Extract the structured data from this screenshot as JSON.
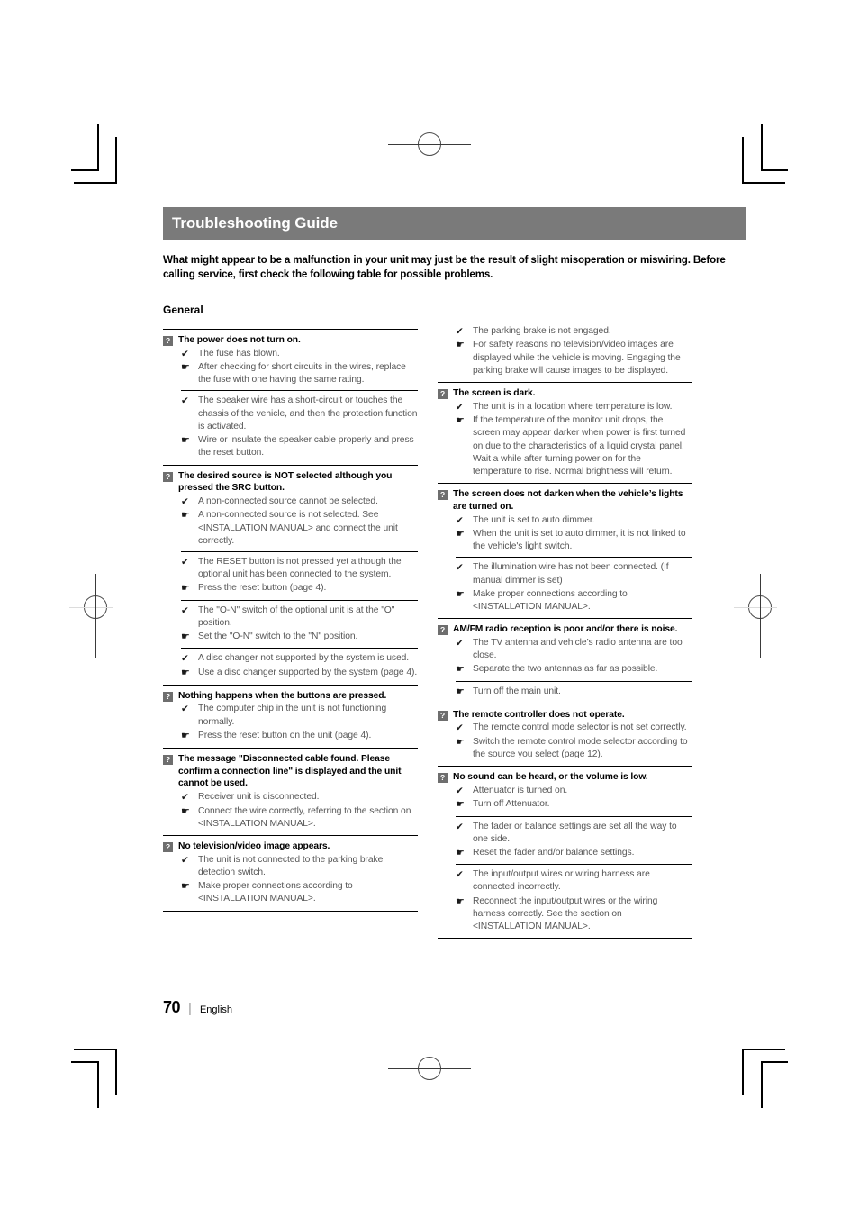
{
  "header": {
    "title": "Troubleshooting Guide",
    "intro": "What might appear to be a malfunction in your unit may just be the result of slight misoperation or miswiring. Before calling service, first check the following table for possible problems.",
    "section": "General"
  },
  "symbols": {
    "question_badge": "?",
    "cause_check": "✔",
    "remedy_hand": "☛"
  },
  "colors": {
    "title_bar_bg": "#7a7a7a",
    "title_bar_text": "#ffffff",
    "badge_bg": "#6e6e6e",
    "body_text": "#565656",
    "rule": "#000000"
  },
  "left_column": [
    {
      "question": "The power does not turn on.",
      "groups": [
        {
          "items": [
            {
              "type": "cause",
              "text": "The fuse has blown."
            },
            {
              "type": "remedy",
              "text": "After checking for short circuits in the wires, replace the fuse with one having the same rating."
            }
          ]
        },
        {
          "items": [
            {
              "type": "cause",
              "text": "The speaker wire has a short-circuit or touches the chassis of the vehicle, and then the protection function is activated."
            },
            {
              "type": "remedy",
              "text": "Wire or insulate the speaker cable properly and press the reset button."
            }
          ]
        }
      ]
    },
    {
      "question": "The desired source is NOT selected although you pressed the SRC button.",
      "groups": [
        {
          "items": [
            {
              "type": "cause",
              "text": "A non-connected source cannot be selected."
            },
            {
              "type": "remedy",
              "text": "A non-connected source is not selected. See <INSTALLATION MANUAL> and connect the unit correctly."
            }
          ]
        },
        {
          "items": [
            {
              "type": "cause",
              "text": "The RESET button is not pressed yet although the optional unit has been connected to the system."
            },
            {
              "type": "remedy",
              "text": "Press the reset button (page 4)."
            }
          ]
        },
        {
          "items": [
            {
              "type": "cause",
              "text": "The \"O-N\" switch of the optional unit is at the \"O\" position."
            },
            {
              "type": "remedy",
              "text": "Set the \"O-N\" switch to the \"N\" position."
            }
          ]
        },
        {
          "items": [
            {
              "type": "cause",
              "text": "A disc changer not supported by the system is used."
            },
            {
              "type": "remedy",
              "text": "Use a disc changer supported by the system (page 4)."
            }
          ]
        }
      ]
    },
    {
      "question": "Nothing happens when the buttons are pressed.",
      "groups": [
        {
          "items": [
            {
              "type": "cause",
              "text": "The computer chip in the unit is not functioning normally."
            },
            {
              "type": "remedy",
              "text": "Press the reset button on the unit (page 4)."
            }
          ]
        }
      ]
    },
    {
      "question": "The message \"Disconnected cable found. Please confirm a connection line\" is displayed and the unit cannot be used.",
      "groups": [
        {
          "items": [
            {
              "type": "cause",
              "text": "Receiver unit is disconnected."
            },
            {
              "type": "remedy",
              "text": "Connect the wire correctly, referring to the section on <INSTALLATION MANUAL>."
            }
          ]
        }
      ]
    },
    {
      "question": "No television/video image appears.",
      "groups": [
        {
          "items": [
            {
              "type": "cause",
              "text": "The unit is not connected to the parking brake detection switch."
            },
            {
              "type": "remedy",
              "text": "Make proper connections according to <INSTALLATION MANUAL>."
            }
          ]
        }
      ],
      "end_rule": true
    }
  ],
  "right_column": [
    {
      "question": null,
      "continuation": true,
      "groups": [
        {
          "items": [
            {
              "type": "cause",
              "text": "The parking brake is not engaged."
            },
            {
              "type": "remedy",
              "text": "For safety reasons no television/video images are displayed while the vehicle is moving. Engaging the parking brake will cause images to be displayed."
            }
          ]
        }
      ]
    },
    {
      "question": "The screen is dark.",
      "groups": [
        {
          "items": [
            {
              "type": "cause",
              "text": "The unit is in a location where temperature is low."
            },
            {
              "type": "remedy",
              "text": "If the temperature of the monitor unit drops, the screen may appear darker when power is first turned on due to the characteristics of a liquid crystal panel. Wait a while after turning power on for the temperature to rise. Normal brightness will return."
            }
          ]
        }
      ]
    },
    {
      "question": "The screen does not darken when the vehicle’s lights are turned on.",
      "groups": [
        {
          "items": [
            {
              "type": "cause",
              "text": "The unit is set to auto dimmer."
            },
            {
              "type": "remedy",
              "text": "When the unit is set to auto dimmer, it is not linked to the vehicle's light switch."
            }
          ]
        },
        {
          "items": [
            {
              "type": "cause",
              "text": "The illumination wire has not been connected. (If manual dimmer is set)"
            },
            {
              "type": "remedy",
              "text": "Make proper connections according to <INSTALLATION MANUAL>."
            }
          ]
        }
      ]
    },
    {
      "question": "AM/FM radio reception is poor and/or there is noise.",
      "groups": [
        {
          "items": [
            {
              "type": "cause",
              "text": "The TV antenna and vehicle’s radio antenna are too close."
            },
            {
              "type": "remedy",
              "text": "Separate the two antennas as far as possible."
            }
          ]
        },
        {
          "items": [
            {
              "type": "remedy",
              "text": "Turn off the main unit."
            }
          ]
        }
      ]
    },
    {
      "question": "The remote controller does not operate.",
      "groups": [
        {
          "items": [
            {
              "type": "cause",
              "text": "The remote control mode selector is not set correctly."
            },
            {
              "type": "remedy",
              "text": "Switch the remote control mode selector according to the source you select (page 12)."
            }
          ]
        }
      ]
    },
    {
      "question": "No sound can be heard, or the volume is low.",
      "groups": [
        {
          "items": [
            {
              "type": "cause",
              "text": "Attenuator is turned on."
            },
            {
              "type": "remedy",
              "text": "Turn off Attenuator."
            }
          ]
        },
        {
          "items": [
            {
              "type": "cause",
              "text": "The fader or balance settings are set all the way to one side."
            },
            {
              "type": "remedy",
              "text": "Reset the fader and/or balance settings."
            }
          ]
        },
        {
          "items": [
            {
              "type": "cause",
              "text": "The input/output wires or wiring harness are connected incorrectly."
            },
            {
              "type": "remedy",
              "text": "Reconnect the input/output wires or the wiring harness correctly. See the section on <INSTALLATION MANUAL>."
            }
          ]
        }
      ],
      "end_rule": true
    }
  ],
  "footer": {
    "page_number": "70",
    "separator": "|",
    "language": "English"
  }
}
